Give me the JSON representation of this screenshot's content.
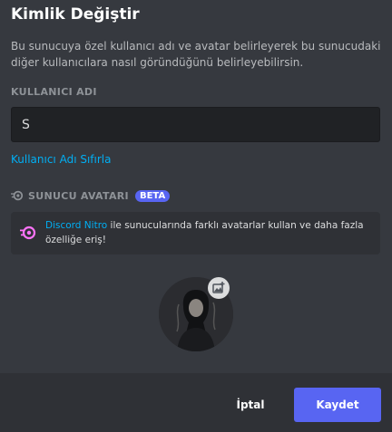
{
  "modal": {
    "title": "Kimlik Değiştir",
    "description": "Bu sunucuya özel kullanıcı adı ve avatar belirleyerek bu sunucudaki diğer kullanıcılara nasıl göründüğünü belirleyebilirsin.",
    "nickname_label": "KULLANICI ADI",
    "nickname_value": "S",
    "reset_link": "Kullanıcı Adı Sıfırla",
    "server_avatar_label": "SUNUCU AVATARI",
    "beta_badge": "BETA",
    "nitro_link": "Discord Nitro",
    "nitro_text": " ile sunucularında farklı avatarlar kullan ve daha fazla özelliğe eriş!"
  },
  "footer": {
    "cancel_label": "İptal",
    "save_label": "Kaydet"
  },
  "colors": {
    "background": "#36393f",
    "footer": "#2f3136",
    "accent": "#5865f2",
    "link": "#00aff4",
    "nitro_pink": "#ff73fa"
  },
  "icons": [
    "nitro-icon",
    "upload-image-icon"
  ]
}
